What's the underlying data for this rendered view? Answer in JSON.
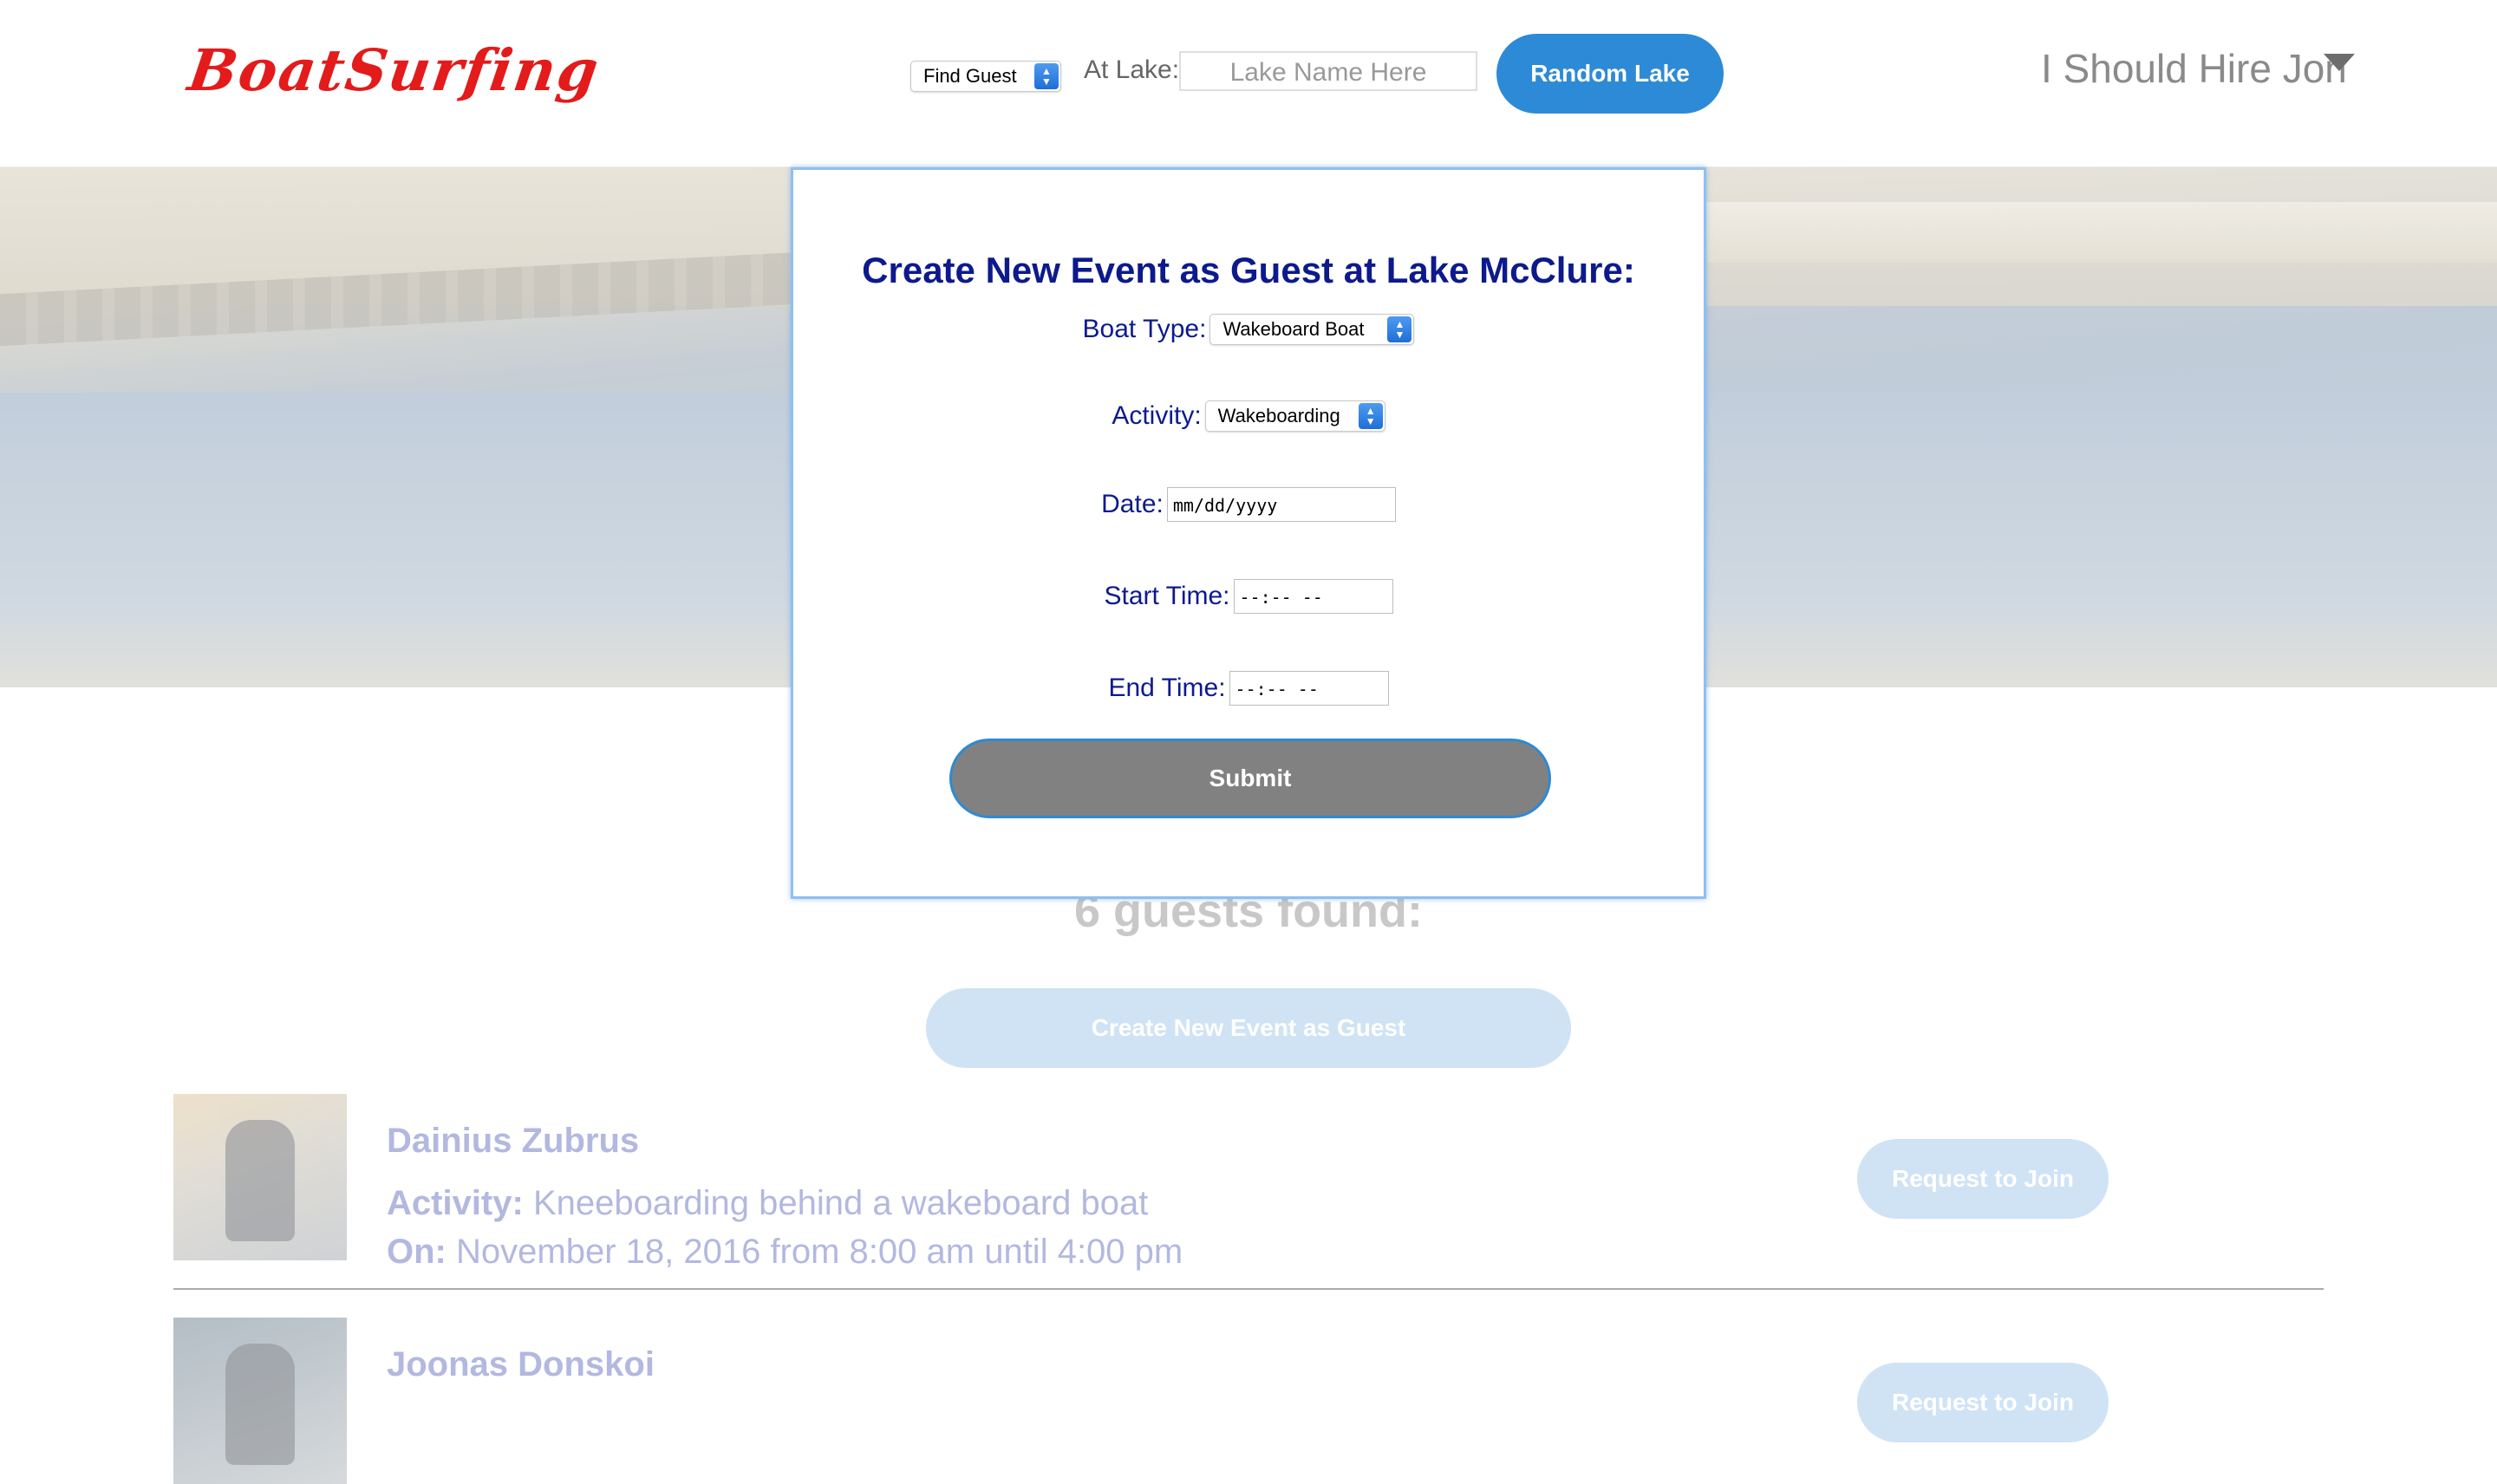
{
  "header": {
    "logo": "BoatSurfing",
    "mode_select": "Find Guest",
    "at_lake_label": "At Lake:",
    "lake_placeholder": "Lake Name Here",
    "random_button": "Random Lake",
    "user_menu": "I Should Hire Jon"
  },
  "modal": {
    "title": "Create New Event as Guest at Lake McClure:",
    "boat_type_label": "Boat Type:",
    "boat_type_value": "Wakeboard Boat",
    "activity_label": "Activity:",
    "activity_value": "Wakeboarding",
    "date_label": "Date:",
    "date_value": "mm/dd/yyyy",
    "start_label": "Start Time:",
    "start_value": "--:-- --",
    "end_label": "End Time:",
    "end_value": "--:-- --",
    "submit": "Submit"
  },
  "results": {
    "count_text": "6 guests found:",
    "create_button": "Create New Event as Guest",
    "guests": [
      {
        "name": "Dainius Zubrus",
        "activity_label": "Activity:",
        "activity": "Kneeboarding behind a wakeboard boat",
        "on_label": "On:",
        "when": "November 18, 2016 from 8:00 am until 4:00 pm",
        "request_button": "Request to Join"
      },
      {
        "name": "Joonas Donskoi",
        "request_button": "Request to Join"
      }
    ]
  },
  "colors": {
    "logo": "#e31b1b",
    "accent_blue": "#2d8ad6",
    "modal_text": "#0d1a8c",
    "submit_bg": "#818181"
  }
}
